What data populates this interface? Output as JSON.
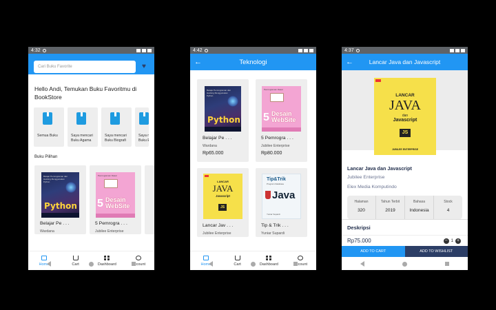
{
  "phone1": {
    "status_time": "4:32",
    "search_placeholder": "Cari Buku Favorite",
    "greeting": "Hello Andi, Temukan Buku Favoritmu di BookStore",
    "categories": [
      {
        "label": "Semua Buku"
      },
      {
        "label": "Saya mencari Buku Agama"
      },
      {
        "label": "Saya mencari Buku Biografi"
      },
      {
        "label": "Saya mencari Buku Ekon"
      }
    ],
    "section_title": "Buku Pilihan",
    "books": [
      {
        "title": "Belajar Pe . . .",
        "author": "Wardana"
      },
      {
        "title": "5 Pemrogra . . .",
        "author": "Jubilee Enterprise"
      }
    ],
    "nav": [
      "Home",
      "Cart",
      "Dashboard",
      "Account"
    ]
  },
  "phone2": {
    "status_time": "4:42",
    "title": "Teknologi",
    "books": [
      {
        "title": "Belajar Pe . . .",
        "author": "Wardana",
        "price": "Rp65.000"
      },
      {
        "title": "5 Pemrogra . . .",
        "author": "Jubilee Enterprise",
        "price": "Rp80.000"
      },
      {
        "title": "Lancar Jav . . .",
        "author": "Jubilee Enterprise"
      },
      {
        "title": "Tip & Trik . . .",
        "author": "Yuniar Supardi"
      }
    ],
    "nav": [
      "Home",
      "Cart",
      "Dashboard",
      "Account"
    ]
  },
  "phone3": {
    "status_time": "4:37",
    "title": "Lancar Java dan Javascript",
    "book_title": "Lancar Java dan Javascript",
    "author": "Jubilee Enterprise",
    "publisher": "Elex Media Komputindo",
    "stats": [
      {
        "label": "Halaman",
        "value": "320"
      },
      {
        "label": "Tahun Terbit",
        "value": "2019"
      },
      {
        "label": "Bahasa",
        "value": "Indonesia"
      },
      {
        "label": "Stock",
        "value": "4"
      }
    ],
    "description_title": "Deskripsi",
    "price": "Rp75.000",
    "quantity": "1",
    "add_to_cart": "ADD TO CART",
    "add_to_wishlist": "ADD TO WISHLIST"
  },
  "covers": {
    "python_word": "Python",
    "python_top": "Belajar Pemrograman dan Hacking Menggunakan Python",
    "pink_top": "Pemrograman Dasar",
    "pink_big": "5",
    "pink_big2": "Desain",
    "pink_big3": "WebSite",
    "java_lancar": "LANCAR",
    "java_java": "JAVA",
    "java_dan": "dan",
    "java_js": "Javascript",
    "java_badge": "JS",
    "java_footer": "JUBILEE ENTERPRISE",
    "tip_title": "Tip&Trik",
    "tip_sub": "Program Database",
    "tip_java": "Java",
    "tip_author": "Yuniar Supardi"
  },
  "colors": {
    "primary": "#2196f3",
    "dark": "#2c3e66"
  }
}
